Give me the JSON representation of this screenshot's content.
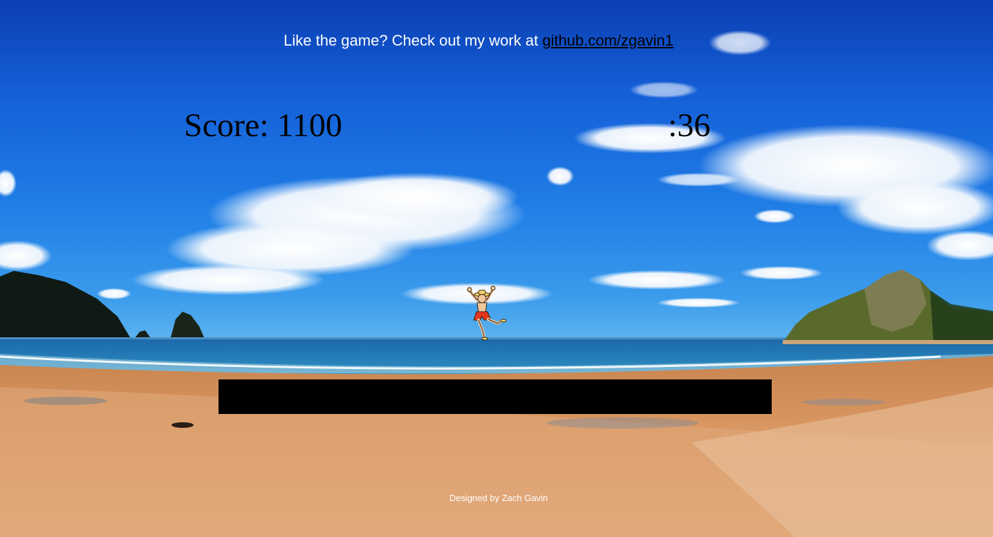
{
  "header": {
    "promo_text": "Like the game? Check out my work at",
    "promo_link": "github.com/zgavin1"
  },
  "hud": {
    "score_label": "Score:",
    "score_value": "1100",
    "timer": ":36"
  },
  "footer": {
    "credit": "Designed by Zach Gavin"
  },
  "scene": {
    "background": "beach-panorama",
    "platform_color": "#000000",
    "player_sprite": "running-man-icon"
  }
}
